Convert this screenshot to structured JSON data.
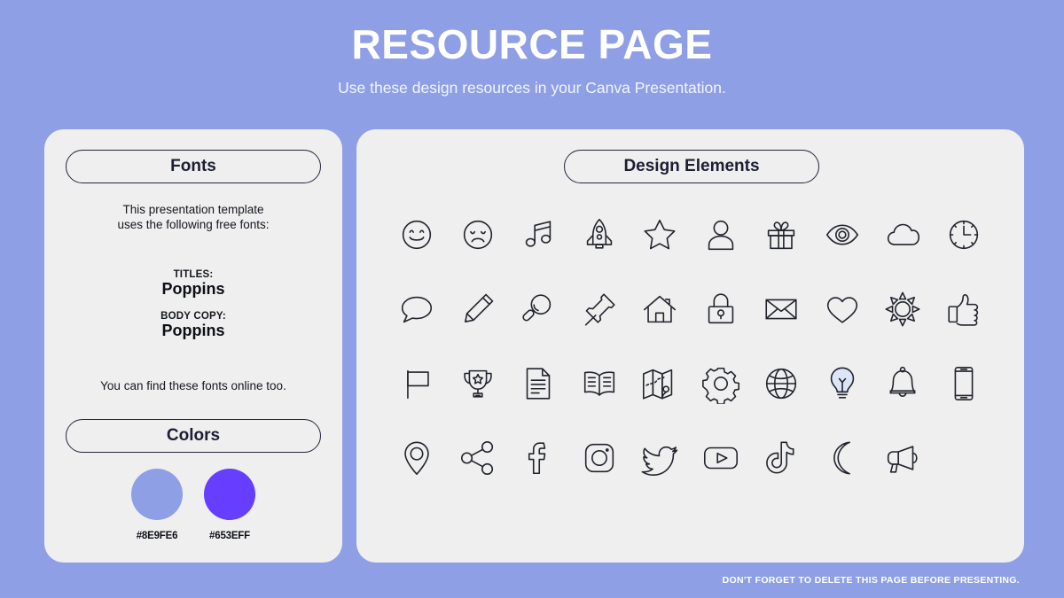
{
  "header": {
    "title": "RESOURCE PAGE",
    "subtitle": "Use these design resources in your Canva Presentation."
  },
  "fonts_panel": {
    "heading": "Fonts",
    "intro_line1": "This presentation template",
    "intro_line2": "uses the following free fonts:",
    "titles_label": "TITLES:",
    "titles_font": "Poppins",
    "body_label": "BODY COPY:",
    "body_font": "Poppins",
    "note": "You can find these fonts online too."
  },
  "colors_panel": {
    "heading": "Colors",
    "swatches": [
      {
        "hex_label": "#8E9FE6",
        "color": "#8e9fe6"
      },
      {
        "hex_label": "#653EFF",
        "color": "#653eff"
      }
    ]
  },
  "elements_panel": {
    "heading": "Design Elements",
    "icons": [
      {
        "name": "smiley-face-icon"
      },
      {
        "name": "sad-face-icon"
      },
      {
        "name": "music-note-icon"
      },
      {
        "name": "rocket-icon"
      },
      {
        "name": "star-icon"
      },
      {
        "name": "person-icon"
      },
      {
        "name": "gift-icon"
      },
      {
        "name": "eye-icon"
      },
      {
        "name": "cloud-icon"
      },
      {
        "name": "clock-icon"
      },
      {
        "name": "speech-bubble-icon"
      },
      {
        "name": "pencil-icon"
      },
      {
        "name": "magnifying-glass-icon"
      },
      {
        "name": "pushpin-icon"
      },
      {
        "name": "house-icon"
      },
      {
        "name": "lock-icon"
      },
      {
        "name": "envelope-icon"
      },
      {
        "name": "heart-icon"
      },
      {
        "name": "sun-icon"
      },
      {
        "name": "thumbs-up-icon"
      },
      {
        "name": "flag-icon"
      },
      {
        "name": "trophy-icon"
      },
      {
        "name": "document-icon"
      },
      {
        "name": "open-book-icon"
      },
      {
        "name": "map-icon"
      },
      {
        "name": "gear-icon"
      },
      {
        "name": "globe-icon"
      },
      {
        "name": "lightbulb-icon"
      },
      {
        "name": "bell-icon"
      },
      {
        "name": "smartphone-icon"
      },
      {
        "name": "location-pin-icon"
      },
      {
        "name": "share-icon"
      },
      {
        "name": "facebook-icon"
      },
      {
        "name": "instagram-icon"
      },
      {
        "name": "twitter-icon"
      },
      {
        "name": "youtube-icon"
      },
      {
        "name": "tiktok-icon"
      },
      {
        "name": "moon-icon"
      },
      {
        "name": "megaphone-icon"
      }
    ]
  },
  "footer": {
    "note": "DON'T FORGET TO DELETE THIS PAGE BEFORE PRESENTING."
  }
}
